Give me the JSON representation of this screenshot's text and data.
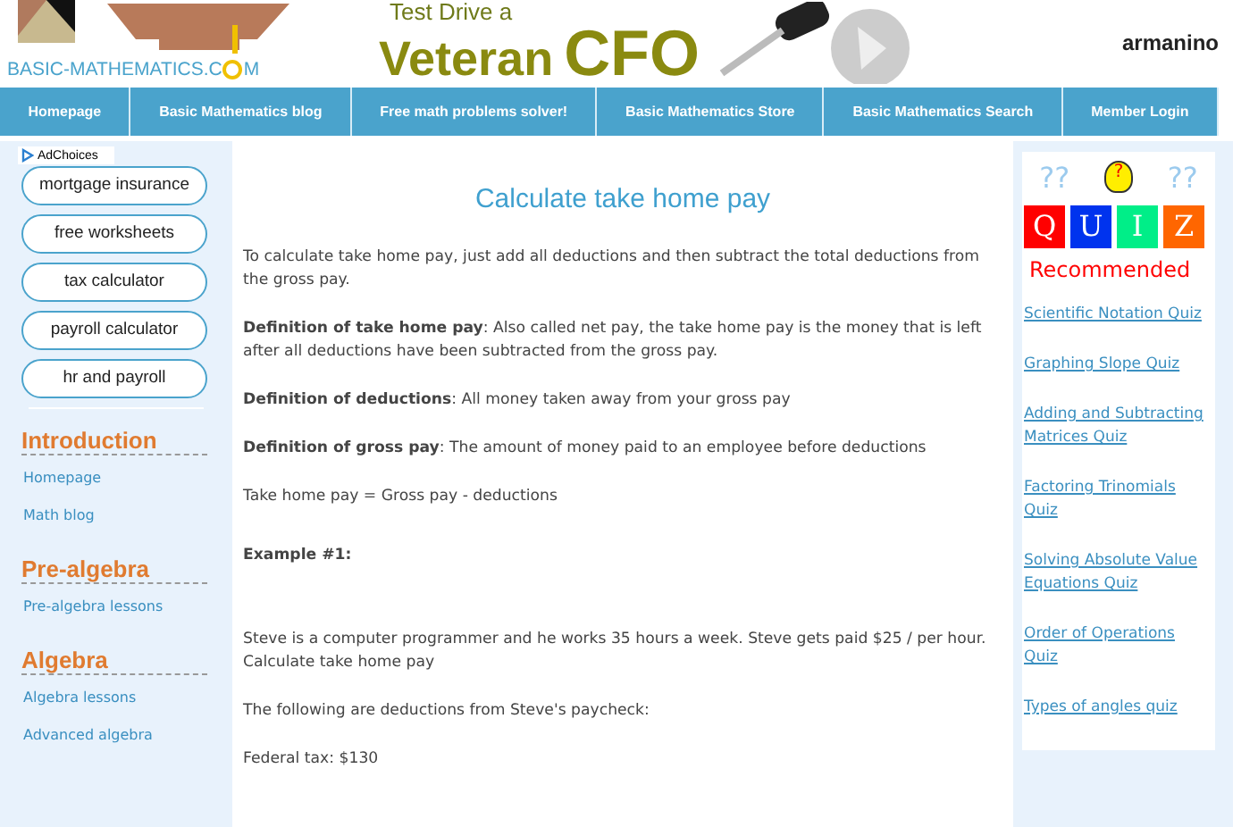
{
  "header": {
    "logo_text": "BASIC-MATHEMATICS.C",
    "logo_text_end": "M",
    "ad": {
      "line1": "Test Drive a",
      "word1": "Veteran",
      "word2": "CFO",
      "brand": "armanino"
    }
  },
  "nav": [
    "Homepage",
    "Basic Mathematics blog",
    "Free math problems solver!",
    "Basic Mathematics Store",
    "Basic Mathematics Search",
    "Member Login"
  ],
  "sidebar": {
    "adchoices": "AdChoices",
    "ad_links": [
      "mortgage insurance",
      "free worksheets",
      "tax calculator",
      "payroll calculator",
      "hr and payroll"
    ],
    "sections": [
      {
        "title": "Introduction",
        "links": [
          "Homepage",
          "Math blog"
        ]
      },
      {
        "title": "Pre-algebra",
        "links": [
          "Pre-algebra lessons"
        ]
      },
      {
        "title": "Algebra",
        "links": [
          "Algebra lessons",
          "Advanced algebra"
        ]
      }
    ]
  },
  "main": {
    "title": "Calculate take home pay",
    "paragraphs": [
      {
        "kind": "text",
        "text": "To calculate take home pay, just add all deductions and then subtract the total deductions from the gross pay."
      },
      {
        "kind": "text",
        "text": "**Definition of take home pay**: Also called net pay, the take home pay is the money that is left after all deductions have been subtracted from the gross pay."
      },
      {
        "kind": "text",
        "text": "**Definition of deductions**: All money taken away from your gross pay"
      },
      {
        "kind": "text",
        "text": "**Definition of gross pay**: The amount of money paid to an employee before deductions"
      },
      {
        "kind": "text",
        "text": "Take home pay = Gross pay - deductions"
      },
      {
        "kind": "heading",
        "text": "Example #1:"
      },
      {
        "kind": "text",
        "text": "Steve is a computer programmer and he works 35 hours a week. Steve gets paid $25 / per hour. Calculate take home pay"
      },
      {
        "kind": "text",
        "text": "The following are deductions from Steve's paycheck:"
      },
      {
        "kind": "text",
        "text": "Federal tax: $130"
      }
    ]
  },
  "quiz": {
    "marks_left": "??",
    "marks_right": "??",
    "bulb_mark": "?",
    "letters": [
      {
        "letter": "Q",
        "color": "#ff0000"
      },
      {
        "letter": "U",
        "color": "#0033ee"
      },
      {
        "letter": "I",
        "color": "#00ee88"
      },
      {
        "letter": "Z",
        "color": "#ff6600"
      }
    ],
    "recommended": "Recommended",
    "links": [
      "Scientific Notation Quiz",
      "Graphing Slope Quiz",
      "Adding and Subtracting Matrices Quiz",
      "Factoring Trinomials Quiz",
      "Solving Absolute Value Equations Quiz",
      "Order of Operations Quiz",
      "Types of angles quiz"
    ]
  }
}
